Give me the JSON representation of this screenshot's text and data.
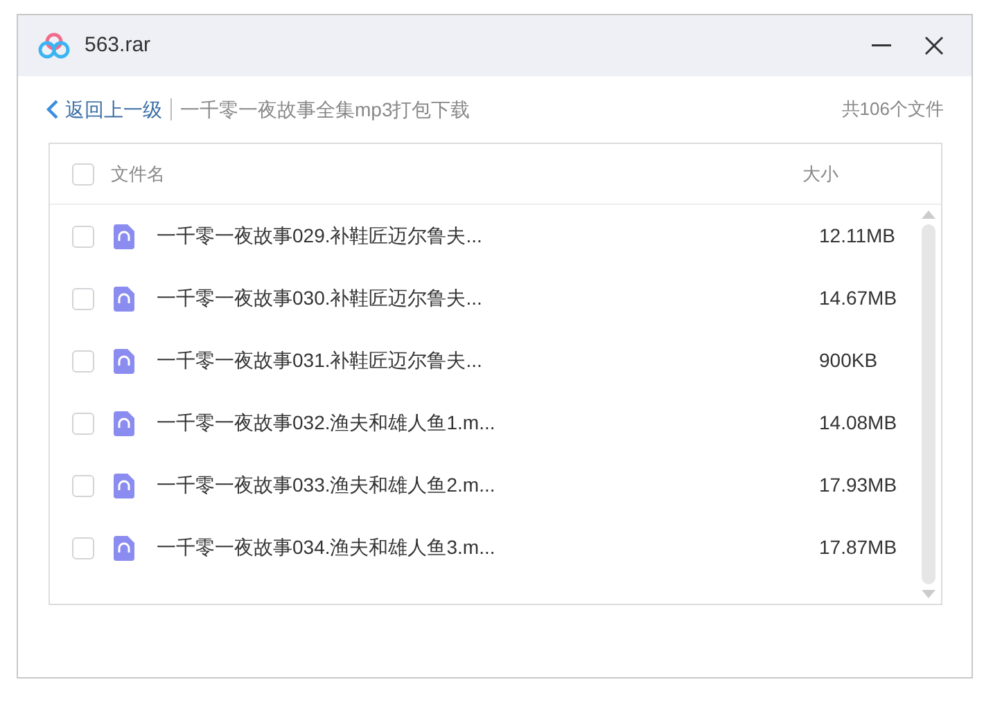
{
  "window": {
    "title": "563.rar"
  },
  "breadcrumb": {
    "back": "返回上一级",
    "path": "一千零一夜故事全集mp3打包下载",
    "count": "共106个文件"
  },
  "table": {
    "select_all_checked": false,
    "columns": [
      "文件名",
      "大小"
    ],
    "rows": [
      {
        "name": "一千零一夜故事029.补鞋匠迈尔鲁夫...",
        "size": "12.11MB",
        "checked": false
      },
      {
        "name": "一千零一夜故事030.补鞋匠迈尔鲁夫...",
        "size": "14.67MB",
        "checked": false
      },
      {
        "name": "一千零一夜故事031.补鞋匠迈尔鲁夫...",
        "size": "900KB",
        "checked": false
      },
      {
        "name": "一千零一夜故事032.渔夫和雄人鱼1.m...",
        "size": "14.08MB",
        "checked": false
      },
      {
        "name": "一千零一夜故事033.渔夫和雄人鱼2.m...",
        "size": "17.93MB",
        "checked": false
      },
      {
        "name": "一千零一夜故事034.渔夫和雄人鱼3.m...",
        "size": "17.87MB",
        "checked": false
      }
    ]
  }
}
